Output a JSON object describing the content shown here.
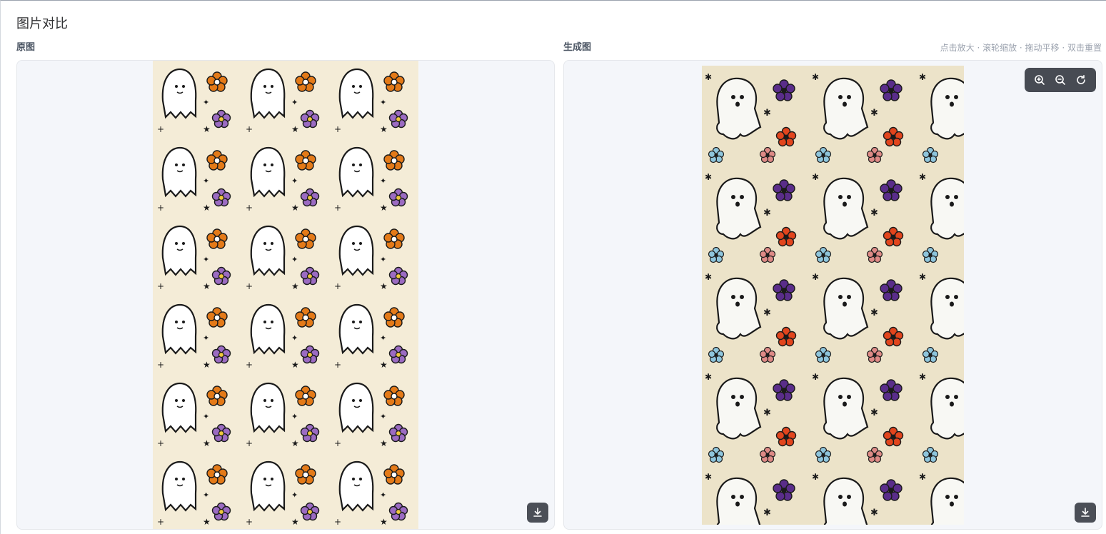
{
  "header": {
    "title": "图片对比"
  },
  "original": {
    "label": "原图"
  },
  "generated": {
    "label": "生成图",
    "hint": "点击放大 · 滚轮缩放 · 拖动平移 · 双击重置"
  },
  "icons": {
    "download": "download-icon",
    "zoom_in": "zoom-in-icon",
    "zoom_out": "zoom-out-icon",
    "reset": "reset-icon"
  },
  "colors": {
    "panel_bg": "#f4f6fa",
    "button_bg": "#4b4f57",
    "pattern_bg_original": "#f4ecd7",
    "pattern_bg_generated": "#ece3c9"
  }
}
